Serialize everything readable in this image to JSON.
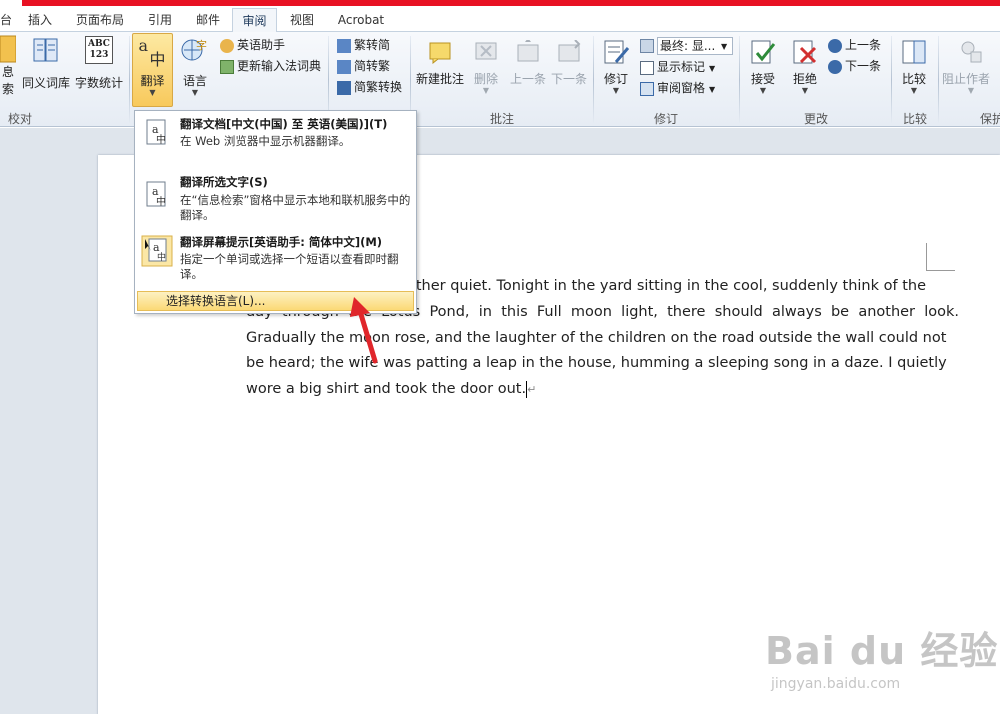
{
  "tabs": [
    {
      "label": "台"
    },
    {
      "label": "插入"
    },
    {
      "label": "页面布局"
    },
    {
      "label": "引用"
    },
    {
      "label": "邮件"
    },
    {
      "label": "审阅"
    },
    {
      "label": "视图"
    },
    {
      "label": "Acrobat"
    }
  ],
  "ribbon": {
    "proofing": {
      "info_search_1": "息",
      "info_search_2": "索",
      "thesaurus": "同义词库",
      "word_count": "字数统计",
      "word_count_icon_text": "ABC\n123",
      "group_label": "校对"
    },
    "language": {
      "translate": "翻译",
      "language": "语言",
      "english_assistant": "英语助手",
      "update_ime_dict": "更新输入法词典",
      "translate_icon_a": "a",
      "translate_icon_zh": "中"
    },
    "chinese_conversion": {
      "trad_to_simp": "繁转简",
      "simp_to_trad": "简转繁",
      "convert": "简繁转换"
    },
    "comments": {
      "new_comment": "新建批注",
      "delete": "删除",
      "previous": "上一条",
      "next": "下一条",
      "group_label": "批注"
    },
    "tracking": {
      "track_changes": "修订",
      "display_select": "最终: 显...",
      "show_markup": "显示标记",
      "reviewing_pane": "审阅窗格",
      "group_label": "修订"
    },
    "changes": {
      "accept": "接受",
      "reject": "拒绝",
      "previous": "上一条",
      "next": "下一条",
      "group_label": "更改"
    },
    "compare": {
      "compare": "比较",
      "group_label": "比较"
    },
    "protect": {
      "block_authors": "阻止作者",
      "group_label": "保护"
    }
  },
  "menu": {
    "items": [
      {
        "title": "翻译文档[中文(中国) 至 英语(美国)](T)",
        "desc": "在 Web 浏览器中显示机器翻译。"
      },
      {
        "title": "翻译所选文字(S)",
        "desc": "在“信息检索”窗格中显示本地和联机服务中的翻译。"
      },
      {
        "title": "翻译屏幕提示[英语助手: 简体中文](M)",
        "desc": "指定一个单词或选择一个短语以查看即时翻译。"
      }
    ],
    "choose_language": "选择转换语言(L)..."
  },
  "document": {
    "text_line1": "rather quiet. Tonight in the yard sitting in the cool, suddenly think of the",
    "text_line2_visible": "day  through  the  Lotus  Pond,  in  this  Full  moon  light,  there  should  always  be  another  look.",
    "text_line3": "Gradually the moon rose, and the laughter of the children on the road outside the wall could not",
    "text_line4": "be heard; the wife was patting a leap in the house, humming a sleeping song in a daze. I quietly",
    "text_line5": "wore a big shirt and took the door out.",
    "para_mark": "↵"
  },
  "watermark": {
    "big": "Bai du 经验",
    "small": "jingyan.baidu.com"
  },
  "colors": {
    "title_bar_red": "#e81123",
    "menu_highlight": "#fbd976",
    "arrow_red": "#e0262b"
  }
}
